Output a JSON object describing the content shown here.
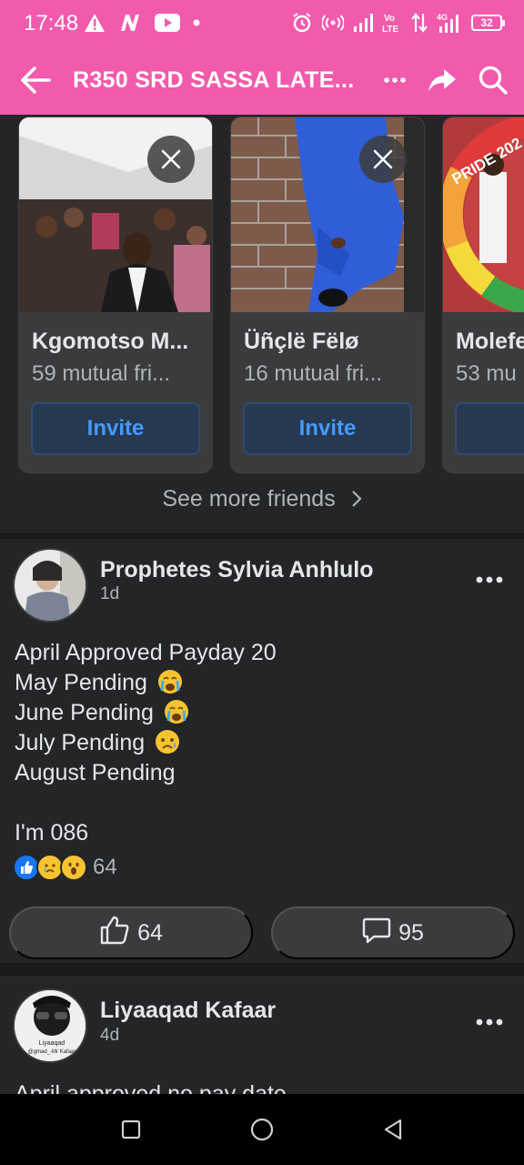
{
  "status_bar": {
    "time": "17:48",
    "battery": "32",
    "icons": [
      "warning-icon",
      "news-icon",
      "youtube-icon",
      "dot-icon",
      "alarm-icon",
      "hotspot-icon",
      "signal-icon",
      "volte-icon",
      "data-arrows-icon",
      "4g-signal-icon",
      "battery-icon"
    ]
  },
  "header": {
    "title": "R350 SRD SASSA LATE...",
    "icons": [
      "back-arrow-icon",
      "more-icon",
      "share-icon",
      "search-icon"
    ],
    "accent_color": "#f25aac"
  },
  "suggested_friends": {
    "cards": [
      {
        "name": "Kgomotso M...",
        "mutual": "59 mutual fri...",
        "button": "Invite"
      },
      {
        "name": "Üñçlë Fëlø",
        "mutual": "16 mutual fri...",
        "button": "Invite"
      },
      {
        "name": "Molefe",
        "mutual": "53 mu",
        "button": "In"
      }
    ],
    "pride_badge": "PRIDE 202",
    "see_more": "See more friends"
  },
  "posts": [
    {
      "author": "Prophetes Sylvia Anhlulo",
      "time": "1d",
      "lines": [
        {
          "text": "April Approved Payday 20",
          "emoji": ""
        },
        {
          "text": "May Pending",
          "emoji": "crying-face"
        },
        {
          "text": "June Pending",
          "emoji": "crying-face"
        },
        {
          "text": "July Pending",
          "emoji": "sad-face"
        },
        {
          "text": "August Pending",
          "emoji": ""
        },
        {
          "text": "",
          "emoji": ""
        },
        {
          "text": "I'm 086",
          "emoji": ""
        }
      ],
      "reactions": [
        "like",
        "sad",
        "wow"
      ],
      "reaction_count": "64",
      "like_count": "64",
      "comment_count": "95"
    },
    {
      "author": "Liyaaqad Kafaar",
      "time": "4d",
      "avatar_text": [
        "Liyaaqad",
        "@gmad_-Mr Kafaar"
      ],
      "preview": "April approved no pay date"
    }
  ],
  "system_nav": [
    "recents-square-icon",
    "home-circle-icon",
    "back-triangle-icon"
  ]
}
